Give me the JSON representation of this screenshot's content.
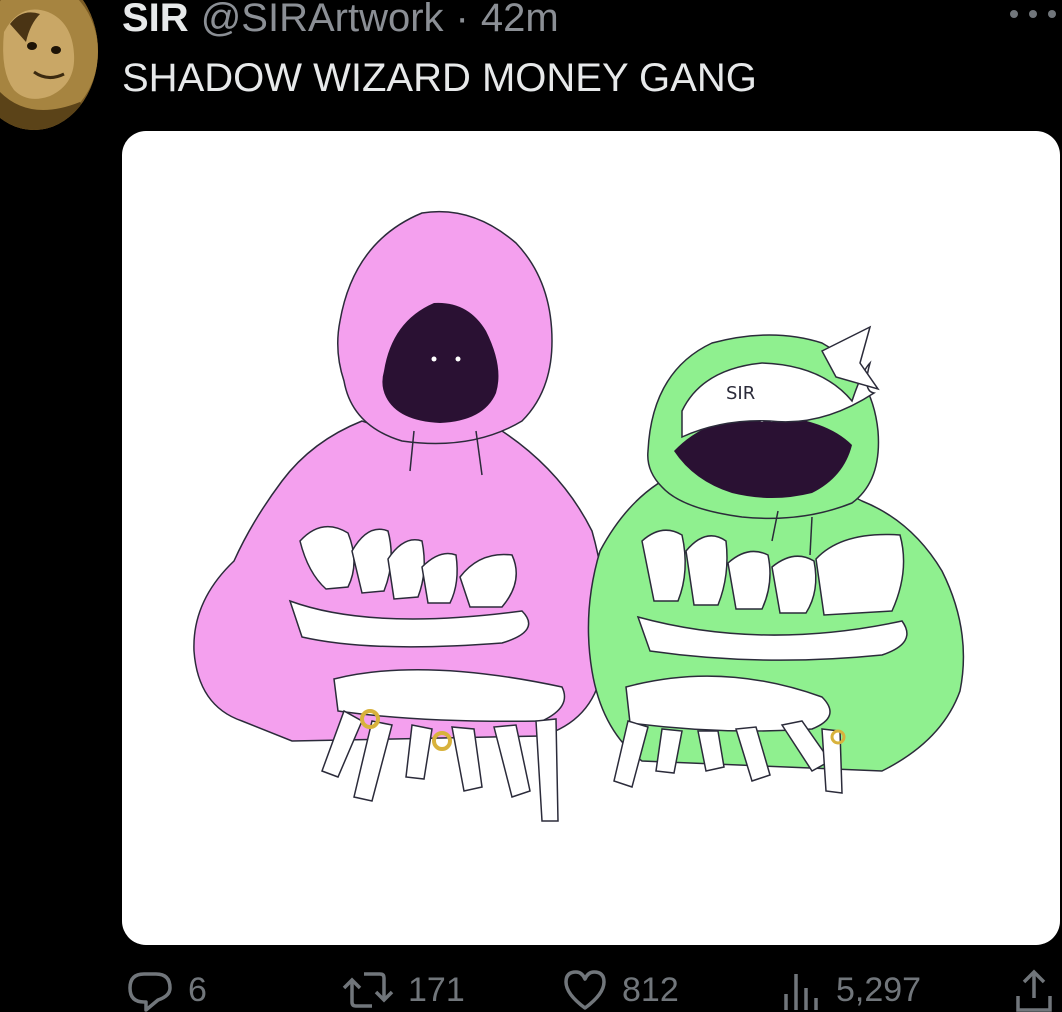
{
  "tweet": {
    "author_name": "SIR",
    "handle": "@SIRArtwork",
    "separator": "·",
    "time": "42m",
    "text": "SHADOW WIZARD MONEY GANG",
    "media_description": "illustration"
  },
  "actions": {
    "replies": "6",
    "retweets": "171",
    "likes": "812",
    "views": "5,297"
  },
  "colors": {
    "background": "#000000",
    "text": "#e7e9ea",
    "muted": "#71767b",
    "pink_hoodie": "#f4a0ee",
    "green_hoodie": "#8ff08f",
    "face": "#2a1133"
  }
}
